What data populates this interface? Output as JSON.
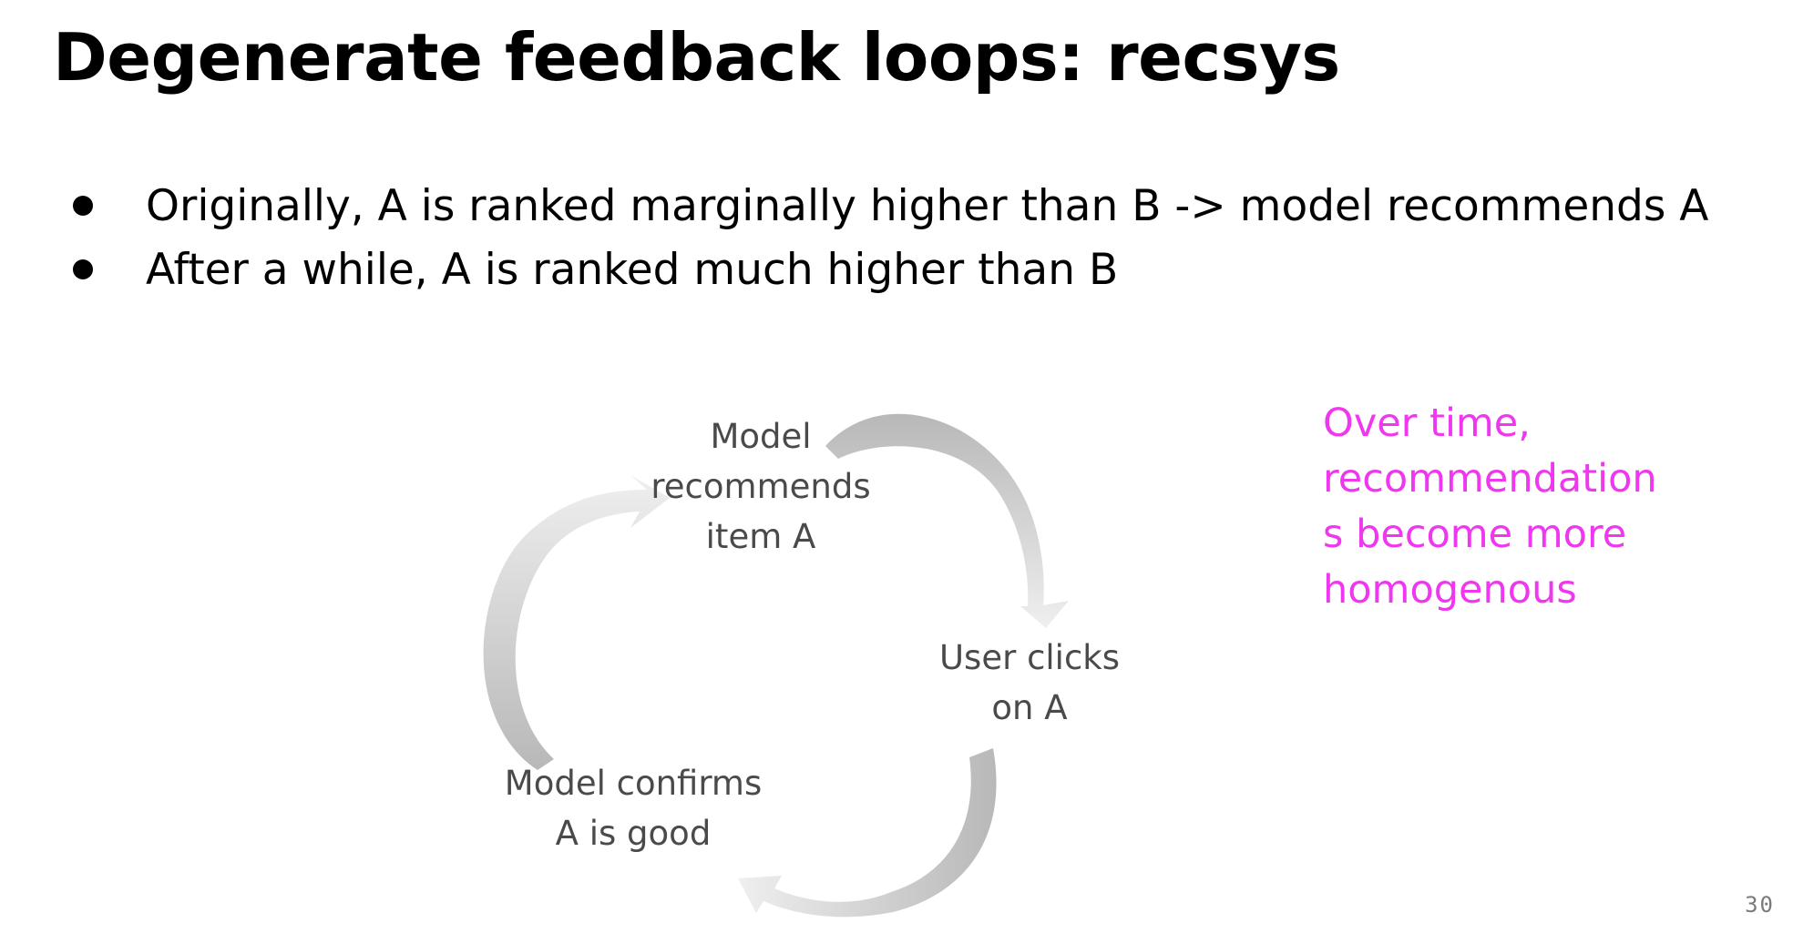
{
  "slide": {
    "title": "Degenerate feedback loops: recsys",
    "bullets": [
      "Originally, A is ranked marginally higher than B -> model recommends A",
      "After a while, A is ranked much higher than B"
    ],
    "page_number": "30"
  },
  "cycle": {
    "nodes": [
      "Model\nrecommends\nitem A",
      "User clicks\non A",
      "Model confirms\nA is good"
    ],
    "arrow_color_dark": "#b8b8b8",
    "arrow_color_light": "#efefef"
  },
  "callout": {
    "text": "Over time,\nrecommendation\ns become more\nhomogenous",
    "color": "#ee37ee"
  }
}
